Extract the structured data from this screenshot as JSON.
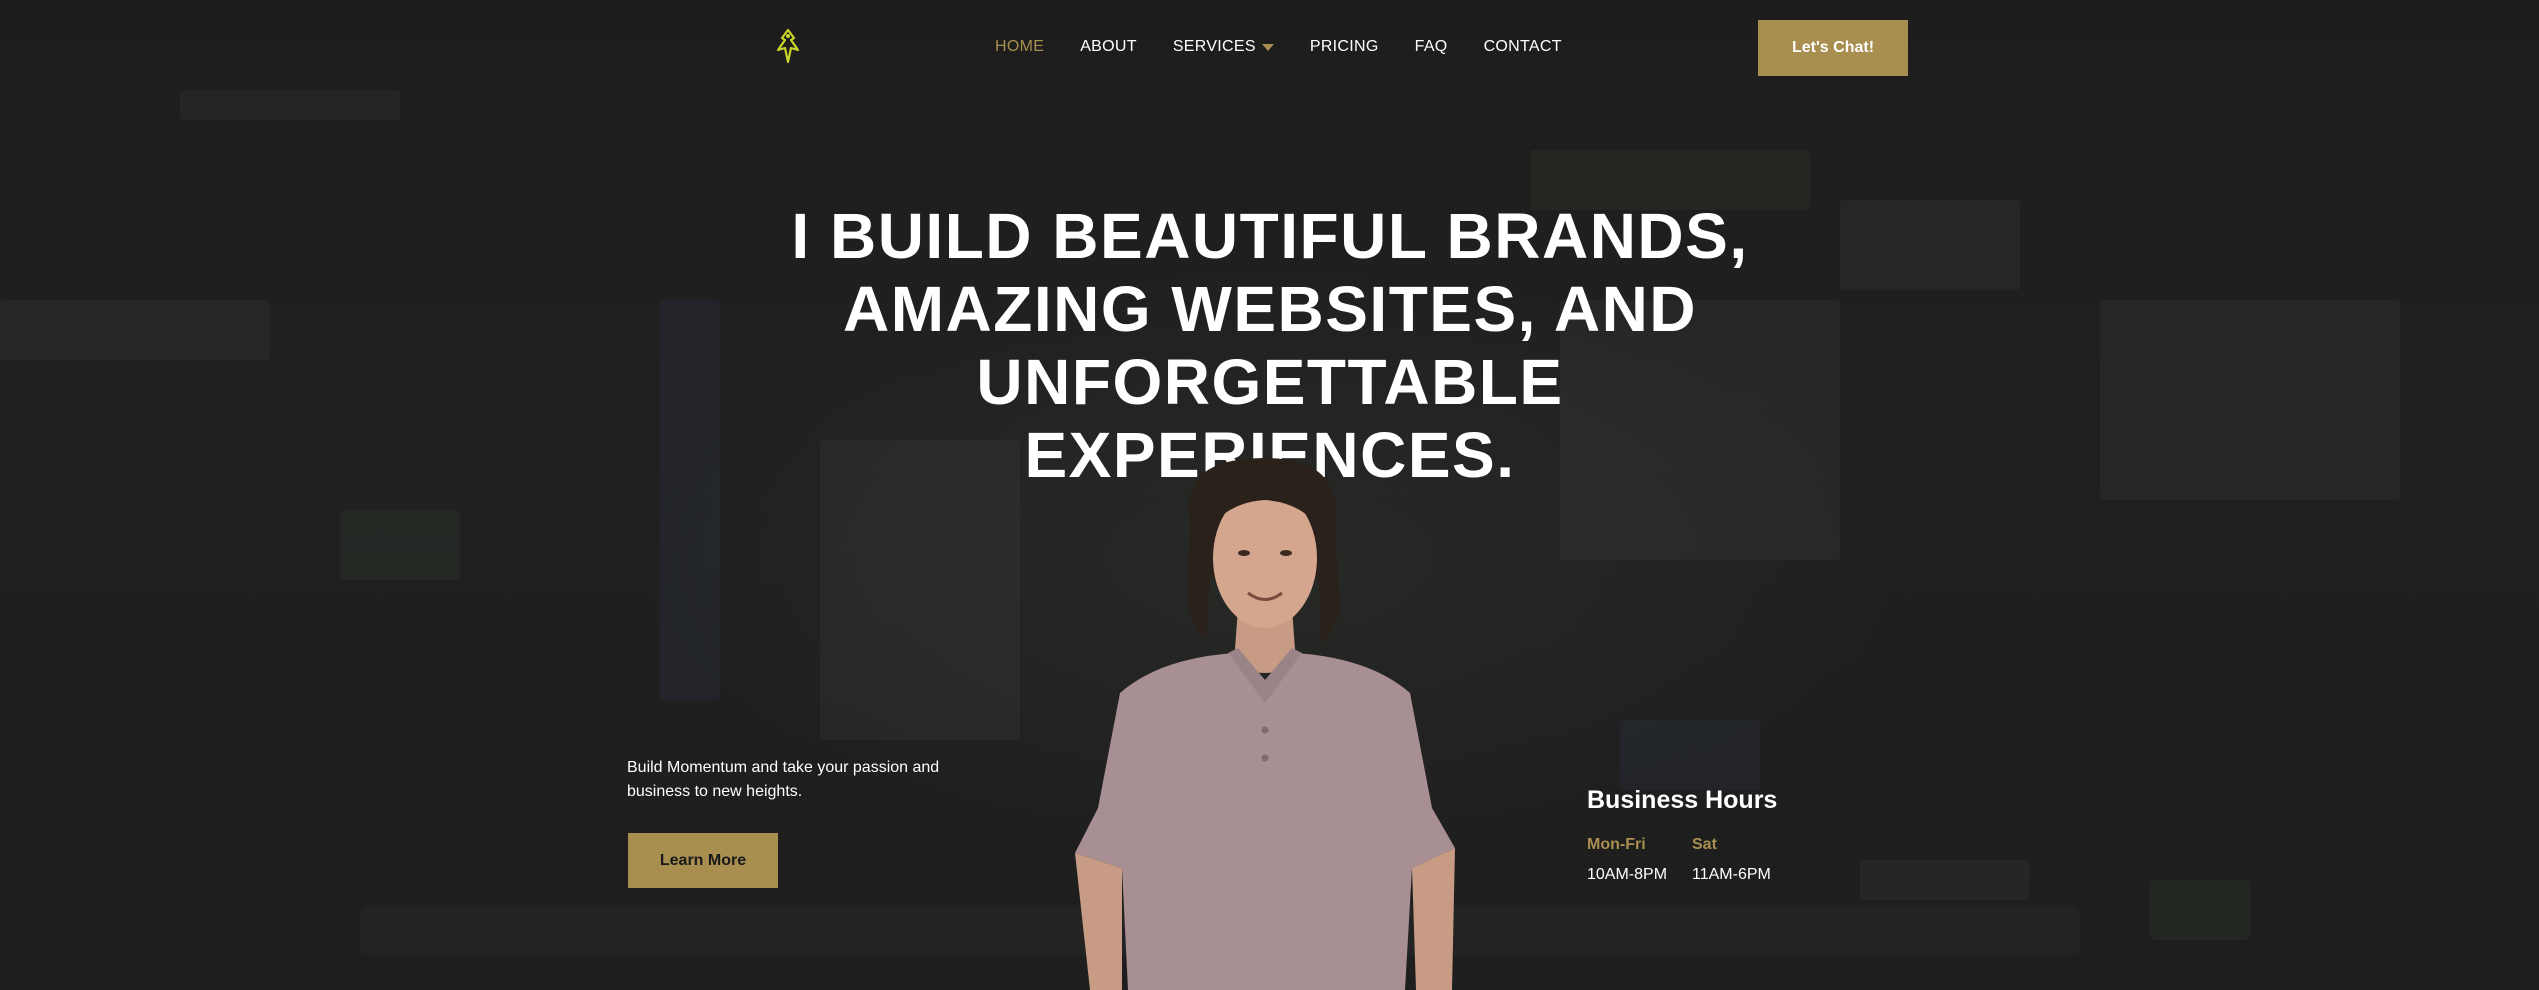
{
  "header": {
    "logo_icon": "eagle-logo-icon",
    "nav": [
      {
        "label": "HOME",
        "active": true
      },
      {
        "label": "ABOUT",
        "active": false
      },
      {
        "label": "SERVICES",
        "active": false,
        "has_dropdown": true
      },
      {
        "label": "PRICING",
        "active": false
      },
      {
        "label": "FAQ",
        "active": false
      },
      {
        "label": "CONTACT",
        "active": false
      }
    ],
    "cta_label": "Let's Chat!"
  },
  "hero": {
    "headline_lines": [
      "I BUILD BEAUTIFUL BRANDS,",
      "AMAZING WEBSITES, AND",
      "UNFORGETTABLE",
      "EXPERIENCES."
    ],
    "tagline": "Build Momentum and take your passion and business to new heights.",
    "learn_more_label": "Learn More"
  },
  "business_hours": {
    "title": "Business Hours",
    "days": [
      {
        "day": "Mon-Fri",
        "time": "10AM-8PM"
      },
      {
        "day": "Sat",
        "time": "11AM-6PM"
      }
    ]
  },
  "colors": {
    "background": "#1c1c1c",
    "accent": "#a88f4f",
    "text": "#ffffff",
    "logo": "#c9d62a"
  }
}
